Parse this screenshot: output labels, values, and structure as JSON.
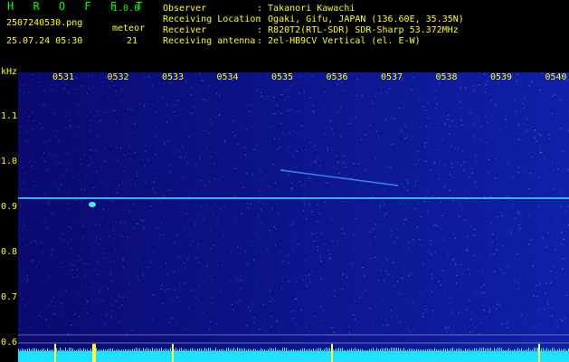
{
  "app": {
    "title": "H R O F F T",
    "version": "1.0.0",
    "filename": "2507240530.png",
    "datetime": "25.07.24 05:30",
    "meteor_label": "meteor",
    "meteor_count": "21"
  },
  "info": [
    {
      "label": "Observer",
      "value": ": Takanori Kawachi"
    },
    {
      "label": "Receiving Location",
      "value": ": Ogaki, Gifu, JAPAN (136.60E, 35.35N)"
    },
    {
      "label": "Receiver",
      "value": ": R820T2(RTL-SDR) SDR-Sharp 53.372MHz"
    },
    {
      "label": "Receiving antenna",
      "value": ": 2el-HB9CV Vertical (el. E-W)"
    }
  ],
  "axis": {
    "y_unit": "kHz",
    "y_ticks": [
      "1.1",
      "1.0",
      "0.9",
      "0.8",
      "0.7",
      "0.6"
    ],
    "x_ticks": [
      "0531",
      "0532",
      "0533",
      "0534",
      "0535",
      "0536",
      "0537",
      "0538",
      "0539",
      "0540"
    ]
  },
  "colors": {
    "background": "#000000",
    "label_yellow": "#ffff00",
    "label_green": "#00ff00",
    "spectrogram_bg": "#0a0a8c",
    "carrier_line": "#3ad0ff",
    "noise_bar": "#20e0ff"
  }
}
